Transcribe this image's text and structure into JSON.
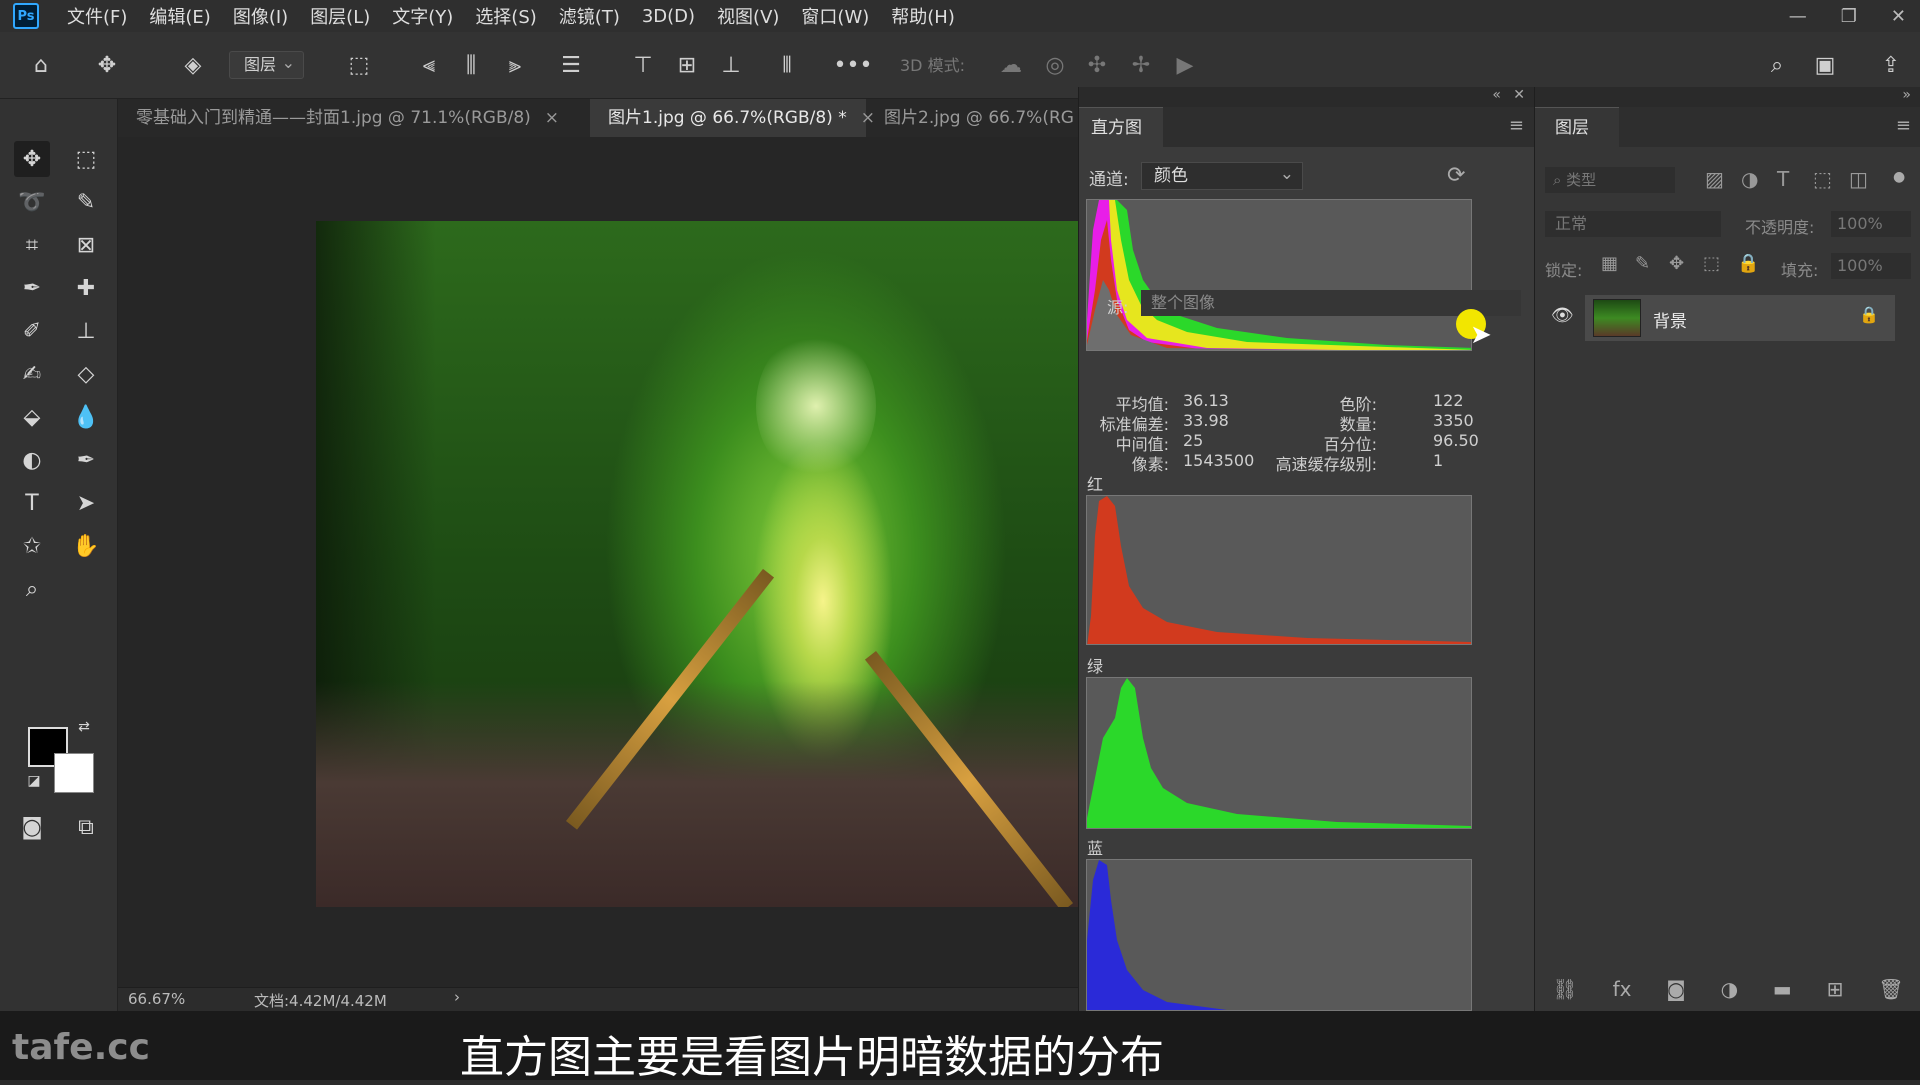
{
  "menubar": {
    "logo": "Ps",
    "items": [
      "文件(F)",
      "编辑(E)",
      "图像(I)",
      "图层(L)",
      "文字(Y)",
      "选择(S)",
      "滤镜(T)",
      "3D(D)",
      "视图(V)",
      "窗口(W)",
      "帮助(H)"
    ]
  },
  "options": {
    "layer_select": "图层",
    "mode3d": "3D 模式:"
  },
  "tabs": [
    {
      "label": "零基础入门到精通——封面1.jpg @ 71.1%(RGB/8)",
      "close": "×"
    },
    {
      "label": "图片1.jpg @ 66.7%(RGB/8) *",
      "close": "×"
    },
    {
      "label": "图片2.jpg @ 66.7%(RG"
    }
  ],
  "status": {
    "zoom": "66.67%",
    "doc": "文档:4.42M/4.42M"
  },
  "histogram": {
    "tab": "直方图",
    "channel_label": "通道:",
    "channel_value": "颜色",
    "source_label": "源:",
    "source_value": "整个图像",
    "stats_left": [
      {
        "label": "平均值:",
        "value": "36.13"
      },
      {
        "label": "标准偏差:",
        "value": "33.98"
      },
      {
        "label": "中间值:",
        "value": "25"
      },
      {
        "label": "像素:",
        "value": "1543500"
      }
    ],
    "stats_right": [
      {
        "label": "色阶:",
        "value": "122"
      },
      {
        "label": "数量:",
        "value": "3350"
      },
      {
        "label": "百分位:",
        "value": "96.50"
      },
      {
        "label": "高速缓存级别:",
        "value": "1"
      }
    ],
    "channels": [
      "红",
      "绿",
      "蓝"
    ],
    "colors": {
      "red": "#d23a1e",
      "green": "#2bd82a",
      "blue": "#2a2ad8",
      "yellow": "#e6e61e",
      "magenta": "#e81ee8"
    }
  },
  "layers": {
    "tab": "图层",
    "filter_placeholder": "类型",
    "blend_mode": "正常",
    "opacity_label": "不透明度:",
    "opacity_value": "100%",
    "lock_label": "锁定:",
    "fill_label": "填充:",
    "fill_value": "100%",
    "layer_name": "背景"
  },
  "subtitle": {
    "watermark": "tafe.cc",
    "text": "直方图主要是看图片明暗数据的分布"
  }
}
